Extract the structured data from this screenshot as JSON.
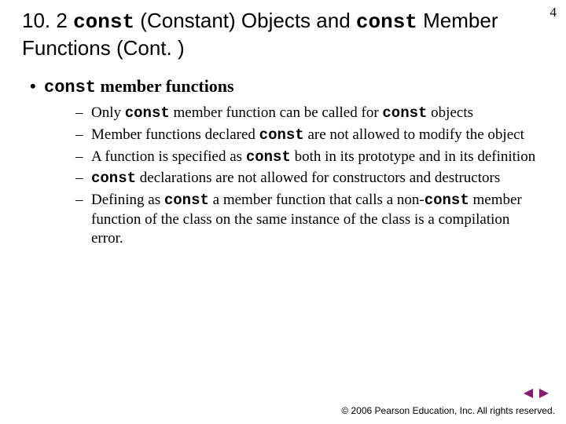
{
  "pageNumber": "4",
  "title": {
    "prefix": "10. 2 ",
    "code1": "const",
    "mid": " (Constant) Objects and ",
    "code2": "const",
    "suffix": " Member Functions (Cont. )"
  },
  "bulletL1": {
    "code": "const",
    "text": " member functions"
  },
  "subItems": {
    "i0": {
      "a": "Only ",
      "b": "const",
      "c": " member function can be called for ",
      "d": "const",
      "e": " objects"
    },
    "i1": {
      "a": "Member functions declared ",
      "b": "const",
      "c": " are not allowed to modify the object"
    },
    "i2": {
      "a": "A function is specified as ",
      "b": "const",
      "c": " both in its prototype and in its definition"
    },
    "i3": {
      "a": "",
      "b": "const",
      "c": " declarations are not allowed for constructors and destructors"
    },
    "i4": {
      "a": "Defining as ",
      "b": "const",
      "c": " a member function that calls a non-",
      "d": "const",
      "e": " member function of the class on the same instance of the class is a compilation error."
    }
  },
  "copyright": "© 2006 Pearson Education, Inc. All rights reserved."
}
